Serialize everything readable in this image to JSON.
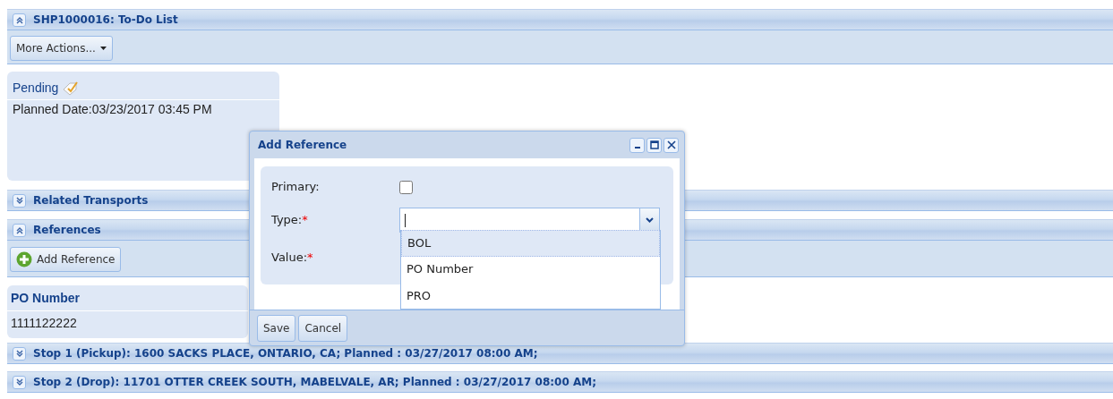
{
  "todo": {
    "title": "SHP1000016: To-Do List",
    "expanded": true,
    "menu_button": "More Actions...",
    "status": "Pending",
    "planned_date": "Planned Date:03/23/2017 03:45 PM"
  },
  "related_transports": {
    "title": "Related Transports",
    "expanded": false
  },
  "references": {
    "title": "References",
    "expanded": true,
    "add_button": "Add Reference",
    "items": [
      {
        "type": "PO Number",
        "value": "1111122222"
      }
    ]
  },
  "stops": [
    {
      "title": "Stop 1 (Pickup): 1600 SACKS PLACE, ONTARIO, CA; Planned : 03/27/2017 08:00 AM;",
      "expanded": false
    },
    {
      "title": "Stop 2 (Drop): 11701 OTTER CREEK SOUTH, MABELVALE, AR; Planned : 03/27/2017 08:00 AM;",
      "expanded": false
    }
  ],
  "dialog": {
    "title": "Add Reference",
    "fields": [
      {
        "kind": "checkbox",
        "label": "Primary:",
        "checked": false
      },
      {
        "kind": "combo",
        "label": "Type:",
        "required_mark": "*"
      },
      {
        "kind": "covered",
        "label": "Value:",
        "required_mark": "*"
      }
    ],
    "options": [
      {
        "label": "BOL",
        "selected": true
      },
      {
        "label": "PO Number",
        "selected": false
      },
      {
        "label": "PRO",
        "selected": false
      }
    ],
    "buttons": [
      "Save",
      "Cancel"
    ]
  }
}
